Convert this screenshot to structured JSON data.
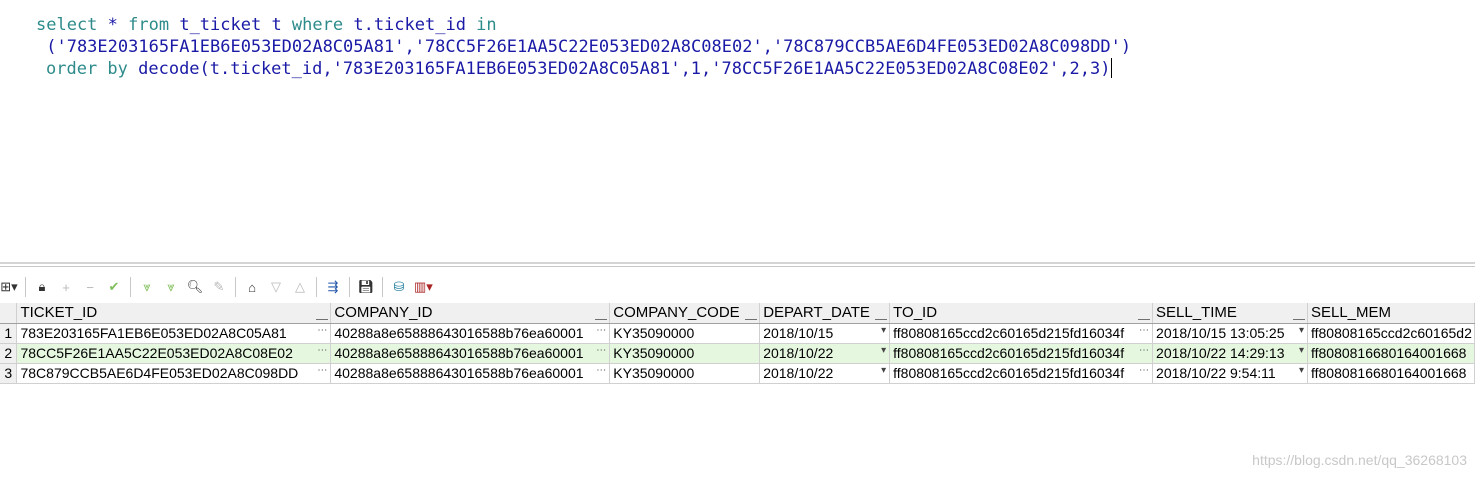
{
  "editor": {
    "line1": {
      "k1": "select",
      "a": " * ",
      "k2": "from",
      "b": " t_ticket t ",
      "k3": "where",
      "c": " t.ticket_id ",
      "k4": "in"
    },
    "line2": " ('783E203165FA1EB6E053ED02A8C05A81','78CC5F26E1AA5C22E053ED02A8C08E02','78C879CCB5AE6D4FE053ED02A8C098DD')",
    "line3": {
      "k1": "order by",
      "rest": " decode(t.ticket_id,'783E203165FA1EB6E053ED02A8C05A81',1,'78CC5F26E1AA5C22E053ED02A8C08E02',2,3)"
    }
  },
  "toolbar": {
    "icons": [
      "grid-menu-icon",
      "lock-icon",
      "add-record-icon",
      "delete-record-icon",
      "post-record-icon",
      "fetch-next-icon",
      "fetch-all-icon",
      "find-icon",
      "clear-icon",
      "query-by-example-icon",
      "filter-down-icon",
      "filter-up-icon",
      "export-icon",
      "save-icon",
      "data-icon",
      "chart-icon"
    ]
  },
  "grid": {
    "columns": [
      "TICKET_ID",
      "COMPANY_ID",
      "COMPANY_CODE",
      "DEPART_DATE",
      "TO_ID",
      "SELL_TIME",
      "SELL_MEM"
    ],
    "rows": [
      {
        "n": "1",
        "cells": [
          "783E203165FA1EB6E053ED02A8C05A81",
          "40288a8e65888643016588b76ea60001",
          "KY35090000",
          "2018/10/15",
          "ff80808165ccd2c60165d215fd16034f",
          "2018/10/15 13:05:25",
          "ff80808165ccd2c60165d2"
        ]
      },
      {
        "n": "2",
        "cells": [
          "78CC5F26E1AA5C22E053ED02A8C08E02",
          "40288a8e65888643016588b76ea60001",
          "KY35090000",
          "2018/10/22",
          "ff80808165ccd2c60165d215fd16034f",
          "2018/10/22 14:29:13",
          "ff8080816680164001668"
        ]
      },
      {
        "n": "3",
        "cells": [
          "78C879CCB5AE6D4FE053ED02A8C098DD",
          "40288a8e65888643016588b76ea60001",
          "KY35090000",
          "2018/10/22",
          "ff80808165ccd2c60165d215fd16034f",
          "2018/10/22 9:54:11",
          "ff8080816680164001668"
        ]
      }
    ]
  },
  "watermark": "https://blog.csdn.net/qq_36268103"
}
